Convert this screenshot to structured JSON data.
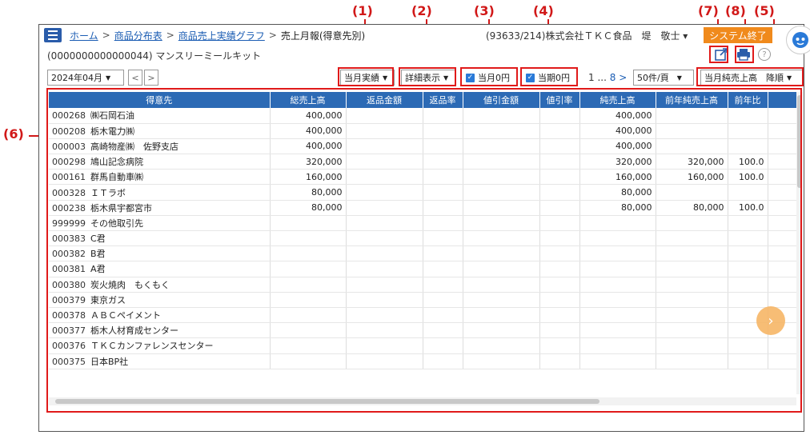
{
  "header": {
    "breadcrumbs": [
      {
        "label": "ホーム",
        "link": true
      },
      {
        "label": "商品分布表",
        "link": true
      },
      {
        "label": "商品売上実績グラフ",
        "link": true
      },
      {
        "label": "売上月報(得意先別)",
        "link": false
      }
    ],
    "separator": ">",
    "company": "(93633/214)株式会社ＴＫＣ食品　堤　敬士 ▾",
    "exit_label": "システム終了",
    "subtitle": "(0000000000000044) マンスリーミールキット"
  },
  "controls": {
    "month": "2024年04月",
    "prev": "<",
    "next": ">",
    "actual_select": "当月実績",
    "detail_select": "詳細表示",
    "check_month_zero": "当月0円",
    "check_period_zero": "当期0円",
    "pager_prefix": "1 ... ",
    "pager_last": "8",
    "pager_next": ">",
    "per_page": "50件/頁",
    "sort_select": "当月純売上高　降順"
  },
  "annotations": {
    "a1": "(1)",
    "a2": "(2)",
    "a3": "(3)",
    "a4": "(4)",
    "a5": "(5)",
    "a6": "(6)",
    "a7": "(7)",
    "a8": "(8)"
  },
  "table": {
    "columns": [
      "得意先",
      "総売上高",
      "返品金額",
      "返品率",
      "値引金額",
      "値引率",
      "純売上高",
      "前年純売上高",
      "前年比"
    ],
    "rows": [
      {
        "code": "000268",
        "name": "㈱石岡石油",
        "total": "400,000",
        "net": "400,000",
        "prev": "",
        "ratio": ""
      },
      {
        "code": "000208",
        "name": "栃木電力㈱",
        "total": "400,000",
        "net": "400,000",
        "prev": "",
        "ratio": ""
      },
      {
        "code": "000003",
        "name": "高崎物産㈱　佐野支店",
        "total": "400,000",
        "net": "400,000",
        "prev": "",
        "ratio": ""
      },
      {
        "code": "000298",
        "name": "鳩山記念病院",
        "total": "320,000",
        "net": "320,000",
        "prev": "320,000",
        "ratio": "100.0"
      },
      {
        "code": "000161",
        "name": "群馬自動車㈱",
        "total": "160,000",
        "net": "160,000",
        "prev": "160,000",
        "ratio": "100.0"
      },
      {
        "code": "000328",
        "name": "ＩＴラボ",
        "total": "80,000",
        "net": "80,000",
        "prev": "",
        "ratio": ""
      },
      {
        "code": "000238",
        "name": "栃木県宇都宮市",
        "total": "80,000",
        "net": "80,000",
        "prev": "80,000",
        "ratio": "100.0"
      },
      {
        "code": "999999",
        "name": "その他取引先",
        "total": "",
        "net": "",
        "prev": "",
        "ratio": ""
      },
      {
        "code": "000383",
        "name": "C君",
        "total": "",
        "net": "",
        "prev": "",
        "ratio": ""
      },
      {
        "code": "000382",
        "name": "B君",
        "total": "",
        "net": "",
        "prev": "",
        "ratio": ""
      },
      {
        "code": "000381",
        "name": "A君",
        "total": "",
        "net": "",
        "prev": "",
        "ratio": ""
      },
      {
        "code": "000380",
        "name": "炭火焼肉　もくもく",
        "total": "",
        "net": "",
        "prev": "",
        "ratio": ""
      },
      {
        "code": "000379",
        "name": "東京ガス",
        "total": "",
        "net": "",
        "prev": "",
        "ratio": ""
      },
      {
        "code": "000378",
        "name": "ＡＢＣペイメント",
        "total": "",
        "net": "",
        "prev": "",
        "ratio": ""
      },
      {
        "code": "000377",
        "name": "栃木人材育成センター",
        "total": "",
        "net": "",
        "prev": "",
        "ratio": ""
      },
      {
        "code": "000376",
        "name": "ＴＫＣカンファレンスセンター",
        "total": "",
        "net": "",
        "prev": "",
        "ratio": ""
      },
      {
        "code": "000375",
        "name": "日本BP社",
        "total": "",
        "net": "",
        "prev": "",
        "ratio": ""
      }
    ]
  },
  "colors": {
    "header_blue": "#2c6ab5",
    "accent_orange": "#f08a1c",
    "annotation_red": "#d11818"
  },
  "icons": {
    "menu": "hamburger-icon",
    "export": "external-link-icon",
    "print": "printer-icon",
    "help": "question-icon",
    "next_page": "chevron-right-icon"
  }
}
